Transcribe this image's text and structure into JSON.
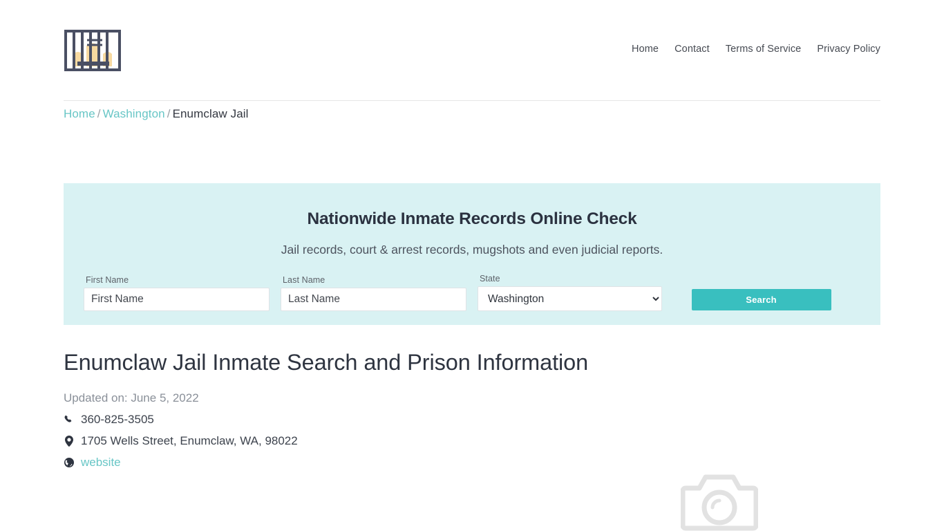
{
  "header": {
    "logo_name": "jail-bars-logo",
    "nav": [
      {
        "label": "Home"
      },
      {
        "label": "Contact"
      },
      {
        "label": "Terms of Service"
      },
      {
        "label": "Privacy Policy"
      }
    ]
  },
  "breadcrumb": {
    "home": "Home",
    "state": "Washington",
    "current": "Enumclaw Jail",
    "separator": "/"
  },
  "search_panel": {
    "title": "Nationwide Inmate Records Online Check",
    "subtitle": "Jail records, court & arrest records, mugshots and even judicial reports.",
    "first_name": {
      "label": "First Name",
      "placeholder": "First Name",
      "value": ""
    },
    "last_name": {
      "label": "Last Name",
      "placeholder": "Last Name",
      "value": ""
    },
    "state": {
      "label": "State",
      "selected": "Washington"
    },
    "search_button": "Search",
    "background_color": "#d9f2f3",
    "button_color": "#39bfbf"
  },
  "article": {
    "title": "Enumclaw Jail Inmate Search and Prison Information",
    "updated": "Updated on: June 5, 2022",
    "phone": "360-825-3505",
    "address": "1705 Wells Street, Enumclaw, WA, 98022",
    "website_label": "website",
    "link_color": "#68c6c6"
  },
  "media": {
    "placeholder_icon": "camera-icon"
  }
}
